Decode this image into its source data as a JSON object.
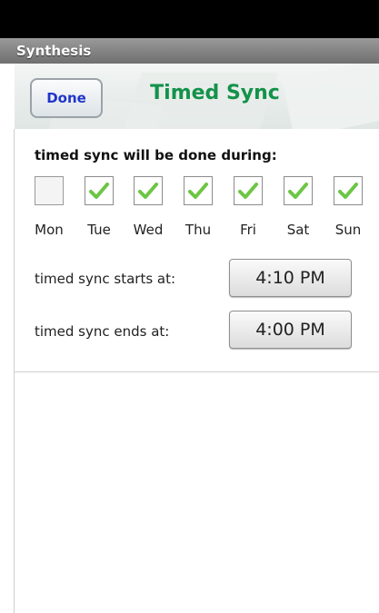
{
  "app": {
    "title": "Synthesis"
  },
  "header": {
    "done_label": "Done",
    "title": "Timed Sync"
  },
  "schedule": {
    "section_label": "timed sync will be done during:",
    "days": [
      {
        "label": "Mon",
        "checked": false
      },
      {
        "label": "Tue",
        "checked": true
      },
      {
        "label": "Wed",
        "checked": true
      },
      {
        "label": "Thu",
        "checked": true
      },
      {
        "label": "Fri",
        "checked": true
      },
      {
        "label": "Sat",
        "checked": true
      },
      {
        "label": "Sun",
        "checked": true
      }
    ],
    "start": {
      "label": "timed sync starts at:",
      "time": "4:10 PM"
    },
    "end": {
      "label": "timed sync ends at:",
      "time": "4:00 PM"
    }
  },
  "colors": {
    "accent_green": "#14924a",
    "done_blue": "#1f36c9",
    "check_green": "#6cc644"
  }
}
